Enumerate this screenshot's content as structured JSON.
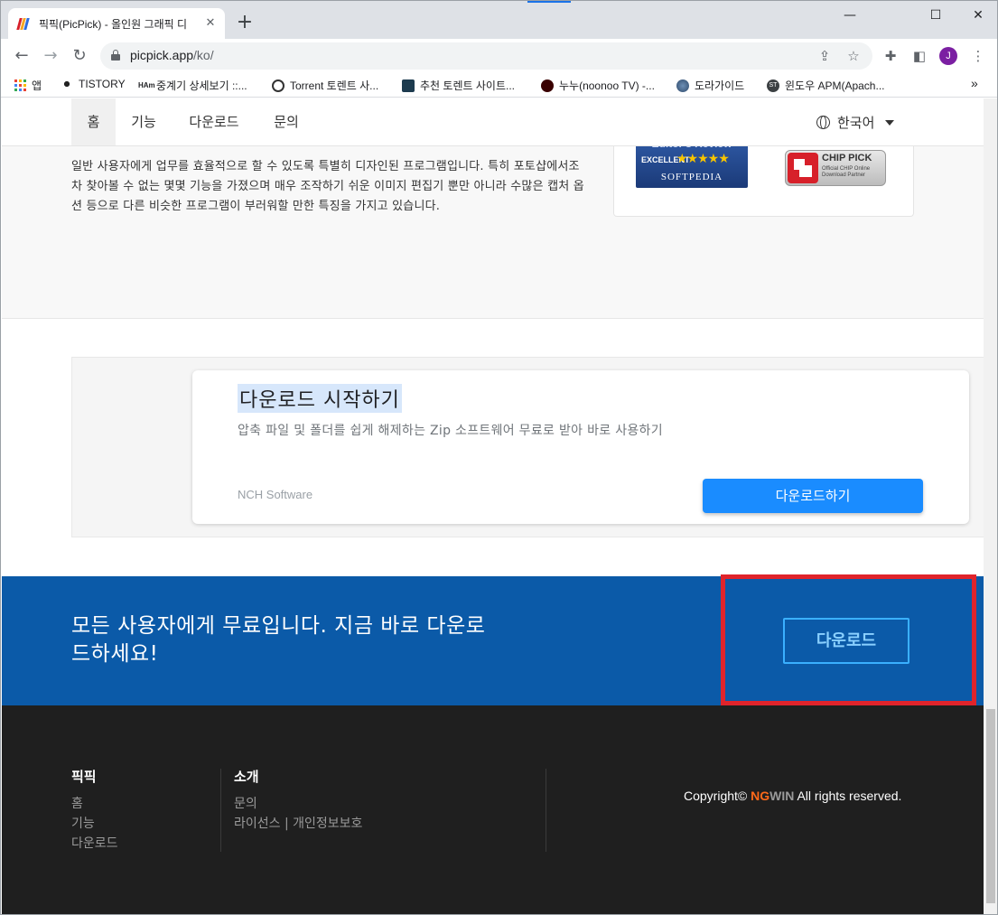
{
  "browser": {
    "tab_title": "픽픽(PicPick) - 올인원 그래픽 디",
    "new_tab": "+",
    "close_tab": "✕",
    "url_host": "picpick.app",
    "url_path": "/ko/",
    "avatar_initial": "J",
    "window_controls": {
      "minimize": "—",
      "maximize": "☐",
      "close": "✕"
    }
  },
  "bookmarks": [
    {
      "label": "앱",
      "icon": "apps-grid-icon"
    },
    {
      "label": "TISTORY",
      "icon": "tistory-icon"
    },
    {
      "label": "중계기 상세보기 ::...",
      "icon": "ham-icon"
    },
    {
      "label": "Torrent 토렌트 사...",
      "icon": "torrent-icon"
    },
    {
      "label": "추천 토렌트 사이트...",
      "icon": "torrent-site-icon"
    },
    {
      "label": "누누(noonoo TV) -...",
      "icon": "noonoo-icon"
    },
    {
      "label": "도라가이드",
      "icon": "globe-icon"
    },
    {
      "label": "윈도우 APM(Apach...",
      "icon": "st-icon"
    }
  ],
  "bookmarks_more": "»",
  "site_nav": {
    "items": [
      "홈",
      "기능",
      "다운로드",
      "문의"
    ],
    "language": "한국어"
  },
  "hero": {
    "description": "일반 사용자에게 업무를 효율적으로 할 수 있도록 특별히 디자인된 프로그램입니다. 특히 포토샵에서조차 찾아볼 수 없는 몇몇 기능을 가졌으며 매우 조작하기 쉬운 이미지 편집기 뿐만 아니라 수많은 캡처 옵션 등으로 다른 비슷한 프로그램이 부러워할 만한 특징을 가지고 있습니다.",
    "softpedia": {
      "top": "Editor's Review",
      "excellent": "EXCELLENT",
      "stars": "★★★★★",
      "name": "SOFTPEDIA"
    },
    "chip": {
      "title": "CHIP PICK",
      "line1": "Official CHIP Online",
      "line2": "Download Partner"
    }
  },
  "ad": {
    "title": "다운로드 시작하기",
    "subtitle": "압축 파일 및 폴더를 쉽게 해제하는 Zip 소프트웨어 무료로 받아 바로 사용하기",
    "brand": "NCH Software",
    "button": "다운로드하기"
  },
  "cta": {
    "text": "모든 사용자에게 무료입니다. 지금 바로 다운로드하세요!",
    "button": "다운로드"
  },
  "footer": {
    "col1": {
      "title": "픽픽",
      "links": [
        "홈",
        "기능",
        "다운로드"
      ]
    },
    "col2": {
      "title": "소개",
      "links": [
        "문의",
        "라이선스 | 개인정보보호"
      ]
    },
    "copyright_prefix": "Copyright©",
    "brand_ng": "NG",
    "brand_win": "WIN",
    "copyright_suffix": "All rights reserved."
  },
  "colors": {
    "cta_background": "#0b5aa8",
    "ad_button": "#1a8cff",
    "highlight_box": "#e0242b",
    "footer_background": "#1f1f1f"
  }
}
